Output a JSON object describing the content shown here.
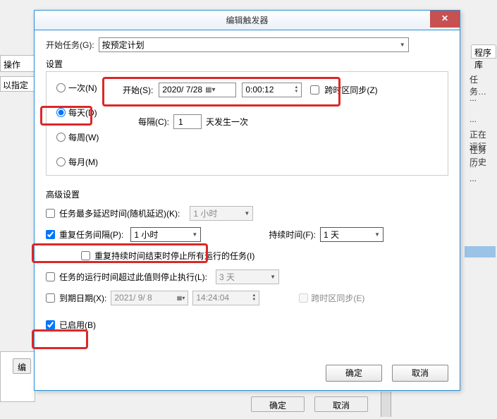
{
  "dialog": {
    "title": "编辑触发器",
    "begin_task_label": "开始任务(G):",
    "begin_task_value": "按预定计划",
    "settings_label": "设置",
    "schedule": {
      "once": "一次(N)",
      "daily": "每天(D)",
      "weekly": "每周(W)",
      "monthly": "每月(M)",
      "selected": "daily"
    },
    "start": {
      "label": "开始(S):",
      "date": "2020/ 7/28",
      "time": "0:00:12",
      "sync_tz": "跨时区同步(Z)"
    },
    "daily": {
      "every_label": "每隔(C):",
      "value": "1",
      "suffix": "天发生一次"
    },
    "advanced_label": "高级设置",
    "adv": {
      "delay_label": "任务最多延迟时间(随机延迟)(K):",
      "delay_value": "1 小时",
      "repeat_label": "重复任务间隔(P):",
      "repeat_value": "1 小时",
      "duration_label": "持续时间(F):",
      "duration_value": "1 天",
      "stop_all_label": "重复持续时间结束时停止所有运行的任务(I)",
      "stop_after_label": "任务的运行时间超过此值则停止执行(L):",
      "stop_after_value": "3 天",
      "expire_label": "到期日期(X):",
      "expire_date": "2021/ 9/ 8",
      "expire_time": "14:24:04",
      "expire_sync": "跨时区同步(E)",
      "enabled_label": "已启用(B)"
    },
    "buttons": {
      "ok": "确定",
      "cancel": "取消"
    }
  },
  "bg": {
    "tab": "程序库",
    "r1": "任务…",
    "r2": "...",
    "r3": "正在运行",
    "r4": "任务历史",
    "r5": "...",
    "op_label": "操作",
    "hint_label": "以指定",
    "edit_btn": "编",
    "outer_ok": "确定",
    "outer_cancel": "取消"
  },
  "highlights": {
    "daily_radio": true,
    "start_row": true,
    "repeat_row": true,
    "enabled_row": true
  }
}
